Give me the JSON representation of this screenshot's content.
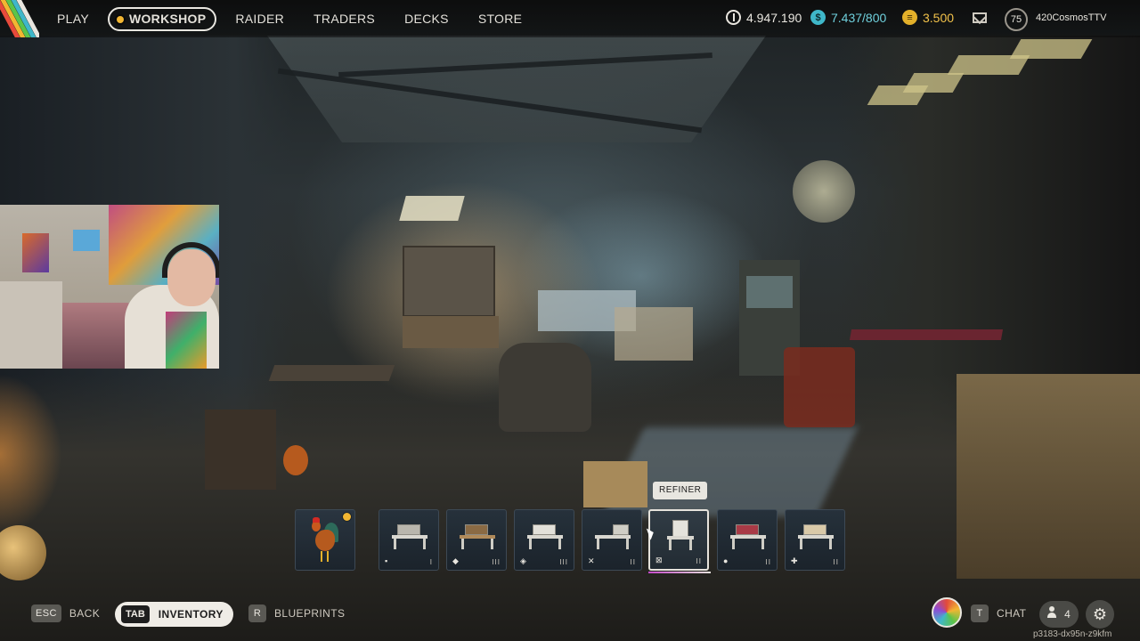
{
  "nav": {
    "items": [
      {
        "label": "PLAY",
        "active": false
      },
      {
        "label": "WORKSHOP",
        "active": true
      },
      {
        "label": "RAIDER",
        "active": false
      },
      {
        "label": "TRADERS",
        "active": false
      },
      {
        "label": "DECKS",
        "active": false
      },
      {
        "label": "STORE",
        "active": false
      }
    ]
  },
  "currencies": {
    "raider_tokens": "4.947.190",
    "creds": "7.437/800",
    "coins": "3.500"
  },
  "profile": {
    "level": "75",
    "username": "420CosmosTTV"
  },
  "hotbar": {
    "tooltip": "REFINER",
    "slots": [
      {
        "name": "rooster",
        "icon": "rooster-icon"
      },
      {
        "name": "workbench",
        "icon": "bench-icon",
        "mini": "▪",
        "tier": "I"
      },
      {
        "name": "gunsmith",
        "icon": "wrench-icon",
        "mini": "◆",
        "tier": "III"
      },
      {
        "name": "gear-bench",
        "icon": "shield-icon",
        "mini": "◈",
        "tier": "III"
      },
      {
        "name": "explosives",
        "icon": "cross-tools-icon",
        "mini": "✕",
        "tier": "II"
      },
      {
        "name": "refiner",
        "icon": "refiner-icon",
        "mini": "⊠",
        "tier": "II",
        "selected": true
      },
      {
        "name": "utility",
        "icon": "pot-icon",
        "mini": "●",
        "tier": "II"
      },
      {
        "name": "medical",
        "icon": "plus-icon",
        "mini": "✚",
        "tier": "II"
      }
    ]
  },
  "bottom": {
    "back_key": "ESC",
    "back_label": "BACK",
    "inventory_key": "TAB",
    "inventory_label": "INVENTORY",
    "blueprints_key": "R",
    "blueprints_label": "BLUEPRINTS",
    "chat_key": "T",
    "chat_label": "CHAT",
    "friends_count": "4",
    "session_id": "p3183-dx95n-z9kfm"
  },
  "colors": {
    "accent_gold": "#f2b632",
    "creds_teal": "#3fb7c9",
    "slot_bg": "#1b232b"
  }
}
